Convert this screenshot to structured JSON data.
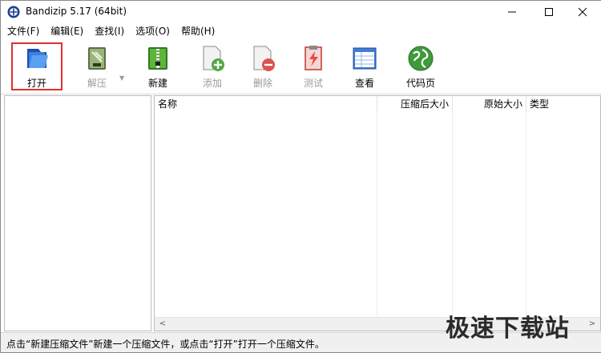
{
  "window": {
    "title": "Bandizip 5.17 (64bit)",
    "icon": "bandizip-app-icon",
    "controls": [
      "minimize-icon",
      "maximize-icon",
      "close-icon"
    ]
  },
  "menu": [
    {
      "label": "文件(F)"
    },
    {
      "label": "编辑(E)"
    },
    {
      "label": "查找(I)"
    },
    {
      "label": "选项(O)"
    },
    {
      "label": "帮助(H)"
    }
  ],
  "toolbar": {
    "open": {
      "label": "打开",
      "icon": "open-folder-icon",
      "highlighted": true,
      "highlight_color": "#e03030"
    },
    "extract": {
      "label": "解压",
      "icon": "extract-archive-icon",
      "enabled": false
    },
    "new": {
      "label": "新建",
      "icon": "new-archive-icon"
    },
    "add": {
      "label": "添加",
      "icon": "add-file-icon",
      "enabled": false
    },
    "delete": {
      "label": "删除",
      "icon": "delete-file-icon",
      "enabled": false
    },
    "test": {
      "label": "测试",
      "icon": "test-archive-icon",
      "enabled": false
    },
    "view": {
      "label": "查看",
      "icon": "view-icon"
    },
    "codepage": {
      "label": "代码页",
      "icon": "codepage-globe-icon"
    }
  },
  "file_list": {
    "columns": [
      "名称",
      "压缩后大小",
      "原始大小",
      "类型"
    ],
    "rows": []
  },
  "status": {
    "text": "点击“新建压缩文件”新建一个压缩文件，或点击“打开”打开一个压缩文件。"
  },
  "watermark": {
    "text": "极速下载站"
  },
  "colors": {
    "accent_blue": "#2f6fd0",
    "green": "#4a9a2a",
    "highlight_red": "#e03030",
    "disabled_text": "#9a9a9a",
    "status_bg": "#f0f0f0"
  }
}
